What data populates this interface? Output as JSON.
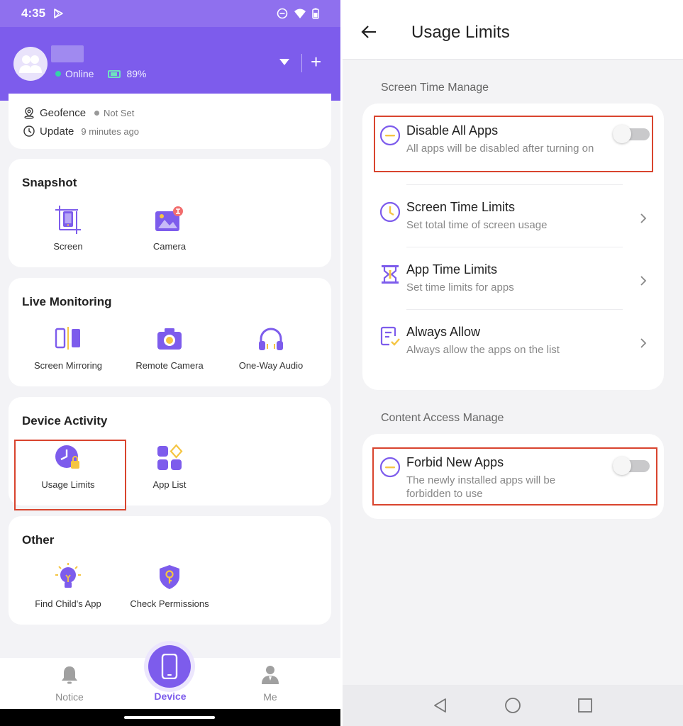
{
  "left": {
    "status": {
      "time": "4:35"
    },
    "header": {
      "online": "Online",
      "battery": "89%"
    },
    "info": {
      "geofence_label": "Geofence",
      "geofence_value": "Not Set",
      "update_label": "Update",
      "update_value": "9 minutes ago"
    },
    "snapshot": {
      "title": "Snapshot",
      "items": [
        "Screen",
        "Camera"
      ]
    },
    "live": {
      "title": "Live Monitoring",
      "items": [
        "Screen Mirroring",
        "Remote Camera",
        "One-Way Audio"
      ]
    },
    "activity": {
      "title": "Device Activity",
      "items": [
        "Usage Limits",
        "App List"
      ]
    },
    "other": {
      "title": "Other",
      "items": [
        "Find Child's App",
        "Check Permissions"
      ]
    },
    "nav": {
      "notice": "Notice",
      "device": "Device",
      "me": "Me"
    },
    "colors": {
      "brand": "#7d5cec",
      "highlight": "#d9442e"
    }
  },
  "right": {
    "title": "Usage Limits",
    "section1": "Screen Time Manage",
    "rows1": [
      {
        "title": "Disable All Apps",
        "subtitle": "All apps will be disabled after turning on",
        "control": "toggle-off"
      },
      {
        "title": "Screen Time Limits",
        "subtitle": "Set total time of screen usage",
        "control": "chevron"
      },
      {
        "title": "App Time Limits",
        "subtitle": "Set time limits for apps",
        "control": "chevron"
      },
      {
        "title": "Always Allow",
        "subtitle": "Always allow the apps on the list",
        "control": "chevron"
      }
    ],
    "section2": "Content Access Manage",
    "rows2": [
      {
        "title": "Forbid New Apps",
        "subtitle": "The newly installed apps will be forbidden to use",
        "control": "toggle-off"
      }
    ]
  }
}
